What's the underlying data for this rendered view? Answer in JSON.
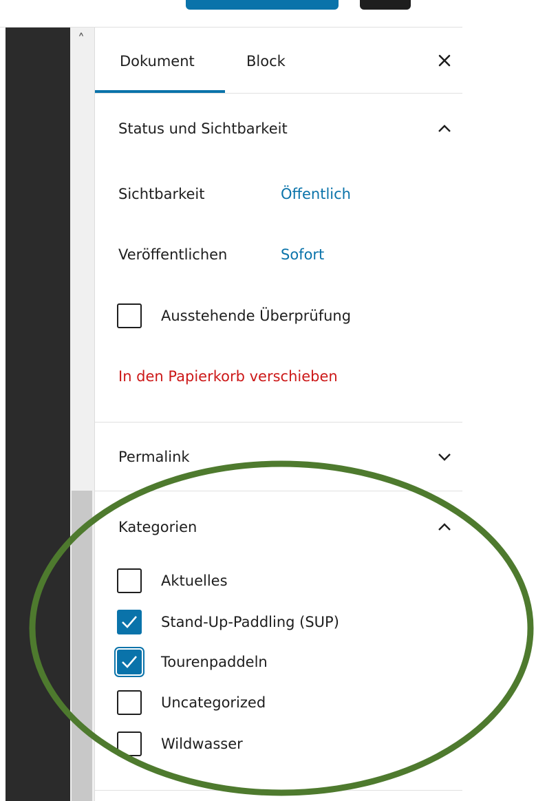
{
  "tabs": {
    "document": "Dokument",
    "block": "Block"
  },
  "status_section": {
    "title": "Status und Sichtbarkeit",
    "visibility_label": "Sichtbarkeit",
    "visibility_value": "Öffentlich",
    "publish_label": "Veröffentlichen",
    "publish_value": "Sofort",
    "pending_review_label": "Ausstehende Überprüfung",
    "trash_label": "In den Papierkorb verschieben"
  },
  "permalink_section": {
    "title": "Permalink"
  },
  "categories_section": {
    "title": "Kategorien",
    "items": [
      {
        "label": "Aktuelles",
        "checked": false
      },
      {
        "label": "Stand-Up-Paddling (SUP)",
        "checked": true
      },
      {
        "label": "Tourenpaddeln",
        "checked": true
      },
      {
        "label": "Uncategorized",
        "checked": false
      },
      {
        "label": "Wildwasser",
        "checked": false
      }
    ]
  },
  "colors": {
    "accent": "#0a73aa",
    "danger": "#cc1818",
    "annotation": "#4e7a2e"
  },
  "icons": {
    "close": "close-icon",
    "expand": "chevron-down-icon",
    "collapse": "chevron-up-icon"
  }
}
